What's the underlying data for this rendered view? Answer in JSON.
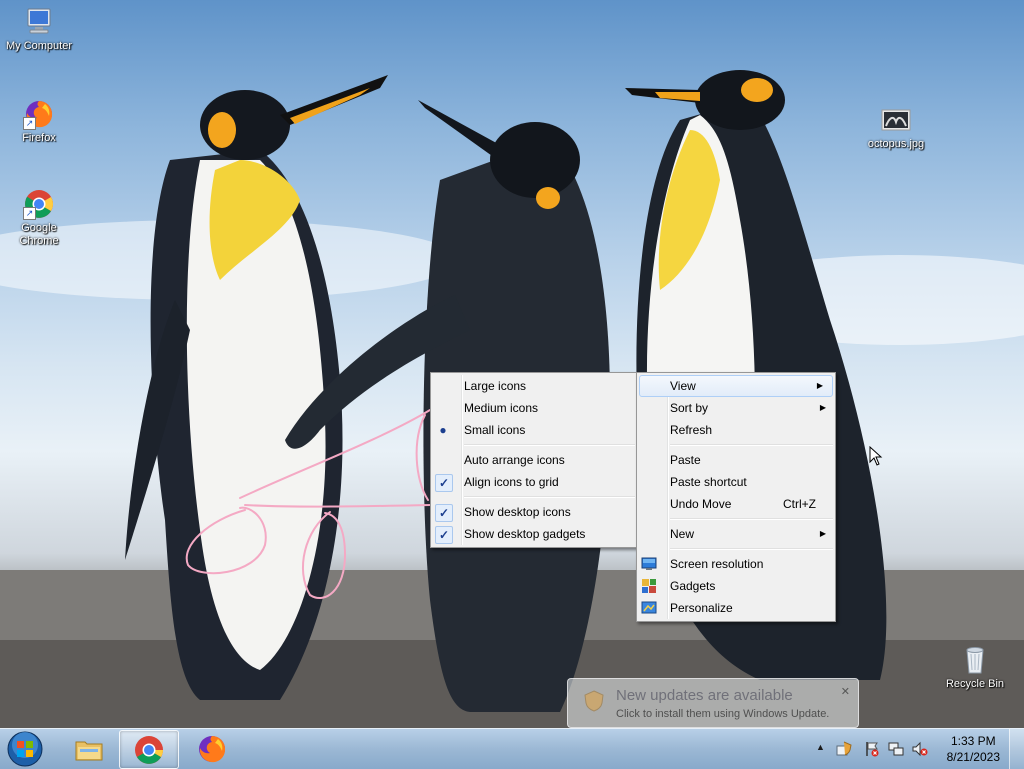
{
  "desktop": {
    "icons": [
      {
        "label": "My Computer",
        "icon": "computer-icon"
      },
      {
        "label": "Firefox",
        "icon": "firefox-icon"
      },
      {
        "label": "Google Chrome",
        "icon": "chrome-icon"
      },
      {
        "label": "octopus.jpg",
        "icon": "image-file-icon"
      },
      {
        "label": "Recycle Bin",
        "icon": "recycle-bin-icon"
      }
    ]
  },
  "view_submenu": {
    "items": [
      {
        "label": "Large icons",
        "mark": ""
      },
      {
        "label": "Medium icons",
        "mark": ""
      },
      {
        "label": "Small icons",
        "mark": "radio-dot"
      },
      {
        "label": "Auto arrange icons",
        "mark": ""
      },
      {
        "label": "Align icons to grid",
        "mark": "checkmark"
      },
      {
        "label": "Show desktop icons",
        "mark": "checkmark"
      },
      {
        "label": "Show desktop gadgets",
        "mark": "checkmark"
      }
    ]
  },
  "context_menu": {
    "items": [
      {
        "label": "View",
        "submenu": true,
        "highlighted": true
      },
      {
        "label": "Sort by",
        "submenu": true
      },
      {
        "label": "Refresh"
      },
      {
        "label": "Paste"
      },
      {
        "label": "Paste shortcut"
      },
      {
        "label": "Undo Move",
        "shortcut": "Ctrl+Z"
      },
      {
        "label": "New",
        "submenu": true
      },
      {
        "label": "Screen resolution",
        "icon": "screen-resolution-icon"
      },
      {
        "label": "Gadgets",
        "icon": "gadgets-icon"
      },
      {
        "label": "Personalize",
        "icon": "personalize-icon"
      }
    ]
  },
  "notification": {
    "title": "New updates are available",
    "text": "Click to install them using Windows Update.",
    "close": "✕"
  },
  "taskbar": {
    "pinned": [
      "explorer-icon",
      "chrome-icon",
      "firefox-icon"
    ],
    "active": "chrome-icon",
    "tray_icons": [
      "show-hidden-icons-arrow",
      "windows-update-icon",
      "action-center-flag-icon",
      "network-icon",
      "volume-muted-icon"
    ],
    "show_hidden_arrow": "▲",
    "clock": {
      "time": "1:33 PM",
      "date": "8/21/2023"
    }
  },
  "colors": {
    "menu_bg": "#f0f0f0",
    "highlight_border": "#aecff7",
    "annotation_stroke": "#f4a9c4"
  }
}
